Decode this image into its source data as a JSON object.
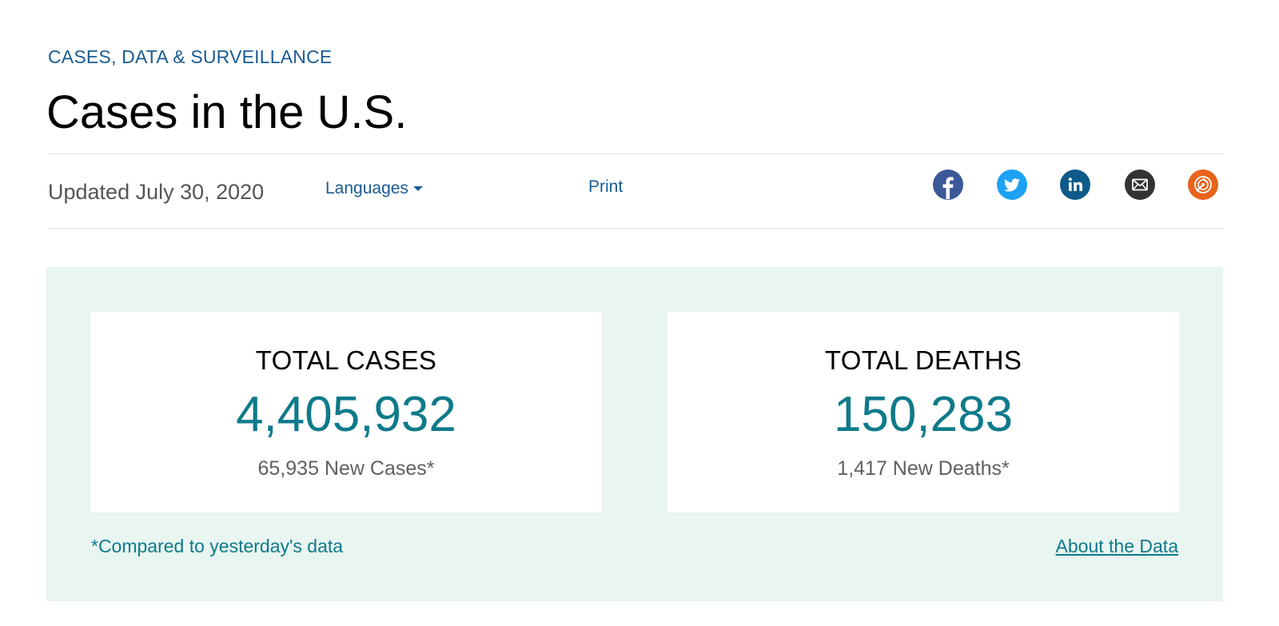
{
  "header": {
    "breadcrumb": "CASES, DATA & SURVEILLANCE",
    "title": "Cases in the U.S."
  },
  "toolbar": {
    "updated": "Updated July 30, 2020",
    "languages_label": "Languages",
    "print_label": "Print",
    "social_icons": [
      "facebook-icon",
      "twitter-icon",
      "linkedin-icon",
      "email-icon",
      "syndicate-icon"
    ]
  },
  "stats": {
    "cases": {
      "label": "TOTAL CASES",
      "value": "4,405,932",
      "sub": "65,935 New Cases*"
    },
    "deaths": {
      "label": "TOTAL DEATHS",
      "value": "150,283",
      "sub": "1,417 New Deaths*"
    },
    "footnote": "*Compared to yesterday's data",
    "about_link": "About the Data"
  },
  "colors": {
    "link": "#1a5b93",
    "accent": "#0e7a8a",
    "panel_bg": "#e8f5f1",
    "facebook": "#3b5998",
    "twitter": "#1da1f2",
    "linkedin": "#0e5a8a",
    "email": "#333333",
    "syndicate": "#e8641b"
  }
}
